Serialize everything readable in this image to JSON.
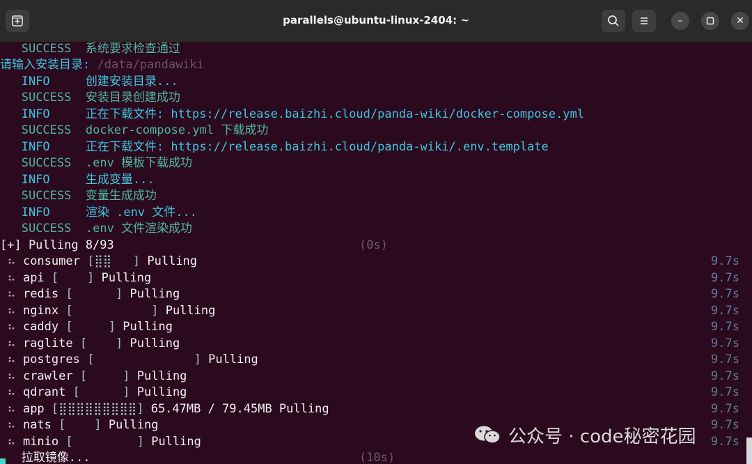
{
  "window": {
    "title": "parallels@ubuntu-linux-2404: ~",
    "new_tab_icon": "new-tab-icon",
    "search_icon": "search-icon",
    "menu_icon": "hamburger-menu-icon",
    "minimize_label": "–",
    "maximize_label": "▫",
    "close_label": "✕"
  },
  "log": [
    {
      "level": "SUCCESS",
      "msg": "系统要求检查通过",
      "cls": "ok"
    },
    {
      "prompt": "请输入安装目录: ",
      "placeholder": "/data/pandawiki"
    },
    {
      "level": "INFO",
      "msg": "创建安装目录...",
      "cls": "info"
    },
    {
      "level": "SUCCESS",
      "msg": "安装目录创建成功",
      "cls": "ok"
    },
    {
      "level": "INFO",
      "msg": "正在下载文件: https://release.baizhi.cloud/panda-wiki/docker-compose.yml",
      "cls": "info"
    },
    {
      "level": "SUCCESS",
      "msg": "docker-compose.yml 下载成功",
      "cls": "ok"
    },
    {
      "level": "INFO",
      "msg": "正在下载文件: https://release.baizhi.cloud/panda-wiki/.env.template",
      "cls": "info"
    },
    {
      "level": "SUCCESS",
      "msg": ".env 模板下载成功",
      "cls": "ok"
    },
    {
      "level": "INFO",
      "msg": "生成变量...",
      "cls": "info"
    },
    {
      "level": "SUCCESS",
      "msg": "变量生成成功",
      "cls": "ok"
    },
    {
      "level": "INFO",
      "msg": "渲染 .env 文件...",
      "cls": "info"
    },
    {
      "level": "SUCCESS",
      "msg": ".env 文件渲染成功",
      "cls": "ok"
    }
  ],
  "pulling": {
    "header": "[+] Pulling 8/93",
    "elapsed": "(0s)",
    "items": [
      {
        "name": "consumer",
        "bar": "[⣿⣿   ]",
        "status": "Pulling",
        "time": "9.7s"
      },
      {
        "name": "api",
        "bar": "[    ]",
        "status": "Pulling",
        "time": "9.7s"
      },
      {
        "name": "redis",
        "bar": "[      ]",
        "status": "Pulling",
        "time": "9.7s"
      },
      {
        "name": "nginx",
        "bar": "[           ]",
        "status": "Pulling",
        "time": "9.7s"
      },
      {
        "name": "caddy",
        "bar": "[     ]",
        "status": "Pulling",
        "time": "9.7s"
      },
      {
        "name": "raglite",
        "bar": "[    ]",
        "status": "Pulling",
        "time": "9.7s"
      },
      {
        "name": "postgres",
        "bar": "[              ]",
        "status": "Pulling",
        "time": "9.7s"
      },
      {
        "name": "crawler",
        "bar": "[     ]",
        "status": "Pulling",
        "time": "9.7s"
      },
      {
        "name": "qdrant",
        "bar": "[      ]",
        "status": "Pulling",
        "time": "9.7s"
      },
      {
        "name": "app",
        "bar": "[⣿⣿⣿⣿⣿⣿⣿⣿⣿]",
        "status": "65.47MB / 79.45MB Pulling",
        "time": "9.7s"
      },
      {
        "name": "nats",
        "bar": "[    ]",
        "status": "Pulling",
        "time": "9.7s"
      },
      {
        "name": "minio",
        "bar": "[         ]",
        "status": "Pulling",
        "time": "9.7s"
      }
    ],
    "footer": "拉取镜像...",
    "footer_elapsed": "(10s)",
    "spinner": "⠦"
  },
  "watermark": {
    "text": "公众号 · code秘密花园",
    "icon": "wechat-icon"
  },
  "colors": {
    "background": "#2b0a1f",
    "success": "#4eb79f",
    "info": "#3fc4dc",
    "time": "#5b7d99"
  }
}
